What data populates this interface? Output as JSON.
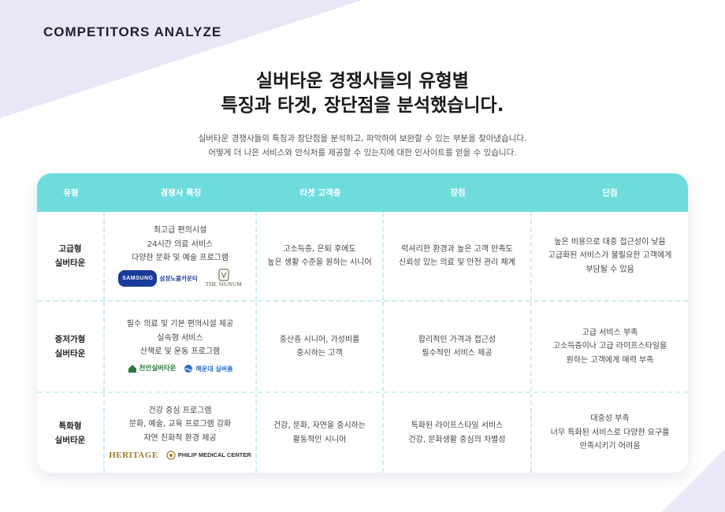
{
  "brand": "COMPETITORS ANALYZE",
  "title": {
    "line1": "실버타운 경쟁사들의 유형별",
    "line2": "특징과 타겟, 장단점을 분석했습니다."
  },
  "subtitle": {
    "line1": "실버타운 경쟁사들의 특징과 장단점을 분석하고, 파악하여 보완할 수 있는 부분을 찾아냈습니다.",
    "line2": "어떻게 더 나은 서비스와 안식처를 제공할 수 있는지에 대한 인사이트를 얻을 수 있습니다."
  },
  "table": {
    "headers": [
      "유형",
      "경쟁사 특징",
      "타겟 고객층",
      "장점",
      "단점"
    ],
    "rows": [
      {
        "type_line1": "고급형",
        "type_line2": "실버타운",
        "features": [
          "최고급 편의시설",
          "24시간 의료 서비스",
          "다양한 문화 및 예술 프로그램"
        ],
        "target": [
          "고소득층, 은퇴 후에도",
          "높은 생활 수준을 원하는 시니어"
        ],
        "pros": [
          "럭셔리한 환경과 높은 고객 만족도",
          "신뢰성 있는 의료 및 안전 관리 체계"
        ],
        "cons": [
          "높은 비용으로 대중 접근성이 낮음",
          "고급화된 서비스가 불필요한 고객에게",
          "부담될 수 있음"
        ],
        "logos": {
          "samsung_pill": "SAMSUNG",
          "samsung_text": "삼성노블카운티",
          "signum": "THE SIGNUM"
        }
      },
      {
        "type_line1": "중저가형",
        "type_line2": "실버타운",
        "features": [
          "필수 의료 및 기본 편의시설 제공",
          "실속형 서비스",
          "산책로 및 운동 프로그램"
        ],
        "target": [
          "중산층 시니어, 가성비를",
          "중시하는 고객"
        ],
        "pros": [
          "합리적인 가격과 접근성",
          "필수적인 서비스 제공"
        ],
        "cons": [
          "고급 서비스 부족",
          "고소득층이나 고급 라이프스타일을",
          "원하는 고객에게 매력 부족"
        ],
        "logos": {
          "green_text": "천안실버타운",
          "blue_text": "해운대 실버홈"
        }
      },
      {
        "type_line1": "특화형",
        "type_line2": "실버타운",
        "features": [
          "건강 중심 프로그램",
          "문화, 예술, 교육 프로그램 강화",
          "자연 친화적 환경 제공"
        ],
        "target": [
          "건강, 문화, 자연을 중시하는",
          "활동적인 시니어"
        ],
        "pros": [
          "특화된 라이프스타일 서비스",
          "건강, 문화생활 중심의 차별성"
        ],
        "cons": [
          "대중성 부족",
          "너무 특화된 서비스로 다양한 요구를",
          "만족시키기 어려움"
        ],
        "logos": {
          "heritage": "HERITAGE",
          "philip": "PHILIP MEDICAL CENTER"
        }
      }
    ]
  },
  "colors": {
    "header_bg": "#6fdcdc",
    "deco": "#e9e6f7"
  }
}
